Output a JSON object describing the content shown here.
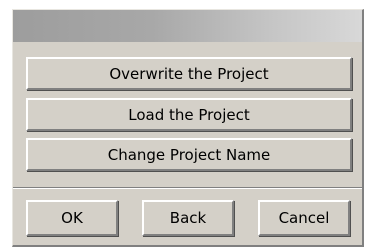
{
  "dialog": {
    "title": "",
    "options": {
      "overwrite_label": "Overwrite the Project",
      "load_label": "Load the Project",
      "rename_label": "Change Project Name"
    },
    "footer": {
      "ok_label": "OK",
      "back_label": "Back",
      "cancel_label": "Cancel"
    }
  },
  "colors": {
    "face": "#d4d0c8",
    "highlight": "#ffffff",
    "shadow": "#808080",
    "titlebar_start": "#9d9d9d",
    "titlebar_end": "#d8d8d8"
  }
}
